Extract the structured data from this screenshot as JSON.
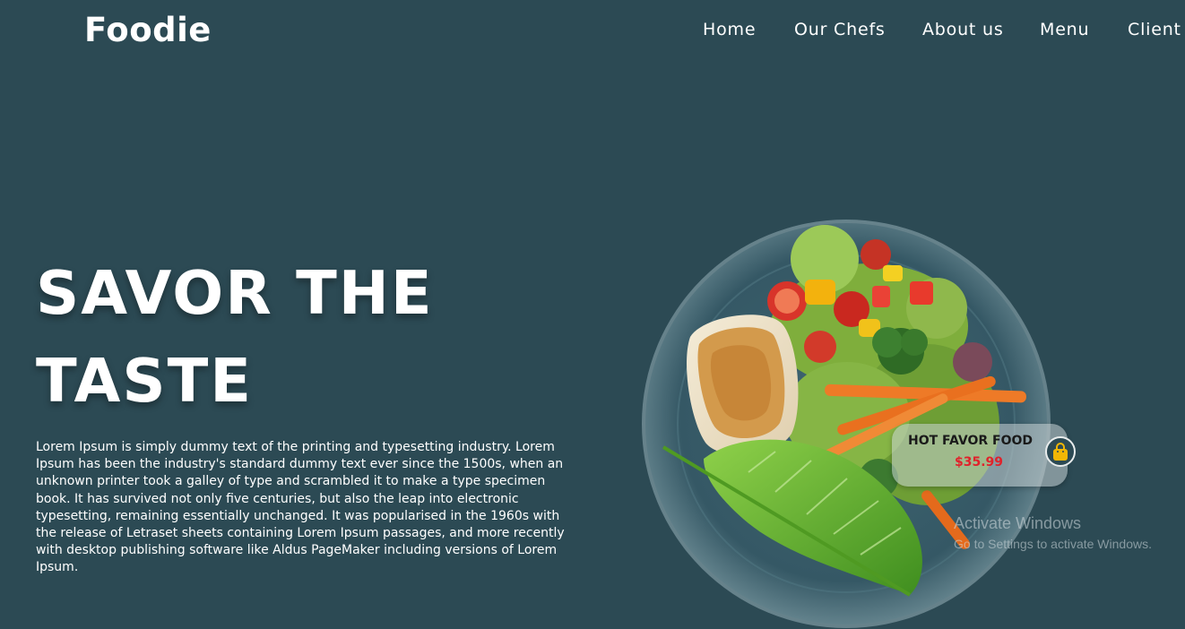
{
  "brand": {
    "logo_text": "Foodie"
  },
  "nav": {
    "items": [
      {
        "label": "Home"
      },
      {
        "label": "Our Chefs"
      },
      {
        "label": "About us"
      },
      {
        "label": "Menu"
      },
      {
        "label": "Client"
      }
    ]
  },
  "hero": {
    "title_line1": "SAVOR THE",
    "title_line2": "TASTE",
    "description": "Lorem Ipsum is simply dummy text of the printing and typesetting industry. Lorem Ipsum has been the industry's standard dummy text ever since the 1500s, when an unknown printer took a galley of type and scrambled it to make a type specimen book. It has survived not only five centuries, but also the leap into electronic typesetting, remaining essentially unchanged. It was popularised in the 1960s with the release of Letraset sheets containing Lorem Ipsum passages, and more recently with desktop publishing software like Aldus PageMaker including versions of Lorem Ipsum."
  },
  "featured": {
    "title": "HOT FAVOR FOOD",
    "price": "$35.99",
    "cart_icon": "shopping-bag-icon"
  },
  "watermark": {
    "title": "Activate Windows",
    "subtitle": "Go to Settings to activate Windows."
  },
  "colors": {
    "background": "#2c4a54",
    "text": "#ffffff",
    "price": "#e0222b",
    "bag": "#f2b705"
  }
}
